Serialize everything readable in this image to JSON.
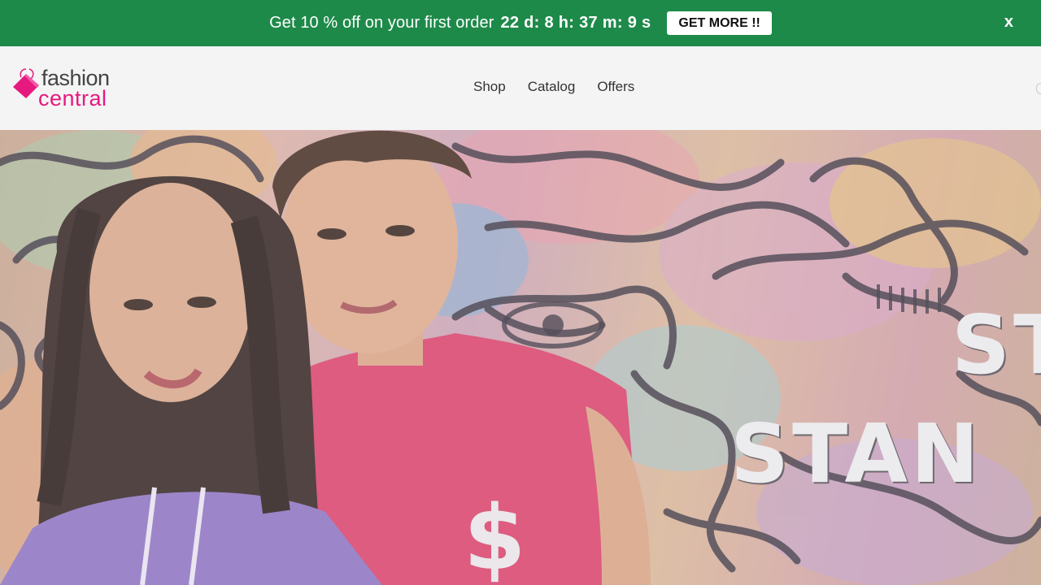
{
  "promo": {
    "text": "Get 10 % off on your first order",
    "countdown": "22 d: 8 h: 37 m: 9 s",
    "button_label": "GET MORE !!",
    "close_label": "x",
    "background_color": "#1e8a4a"
  },
  "header": {
    "logo": {
      "word_1": "fashion",
      "word_2": "central",
      "accent_color": "#e6197e"
    },
    "nav": [
      {
        "label": "Shop"
      },
      {
        "label": "Catalog"
      },
      {
        "label": "Offers"
      }
    ]
  },
  "hero": {
    "headline_line_1": "ST",
    "headline_line_2": "STAN"
  }
}
